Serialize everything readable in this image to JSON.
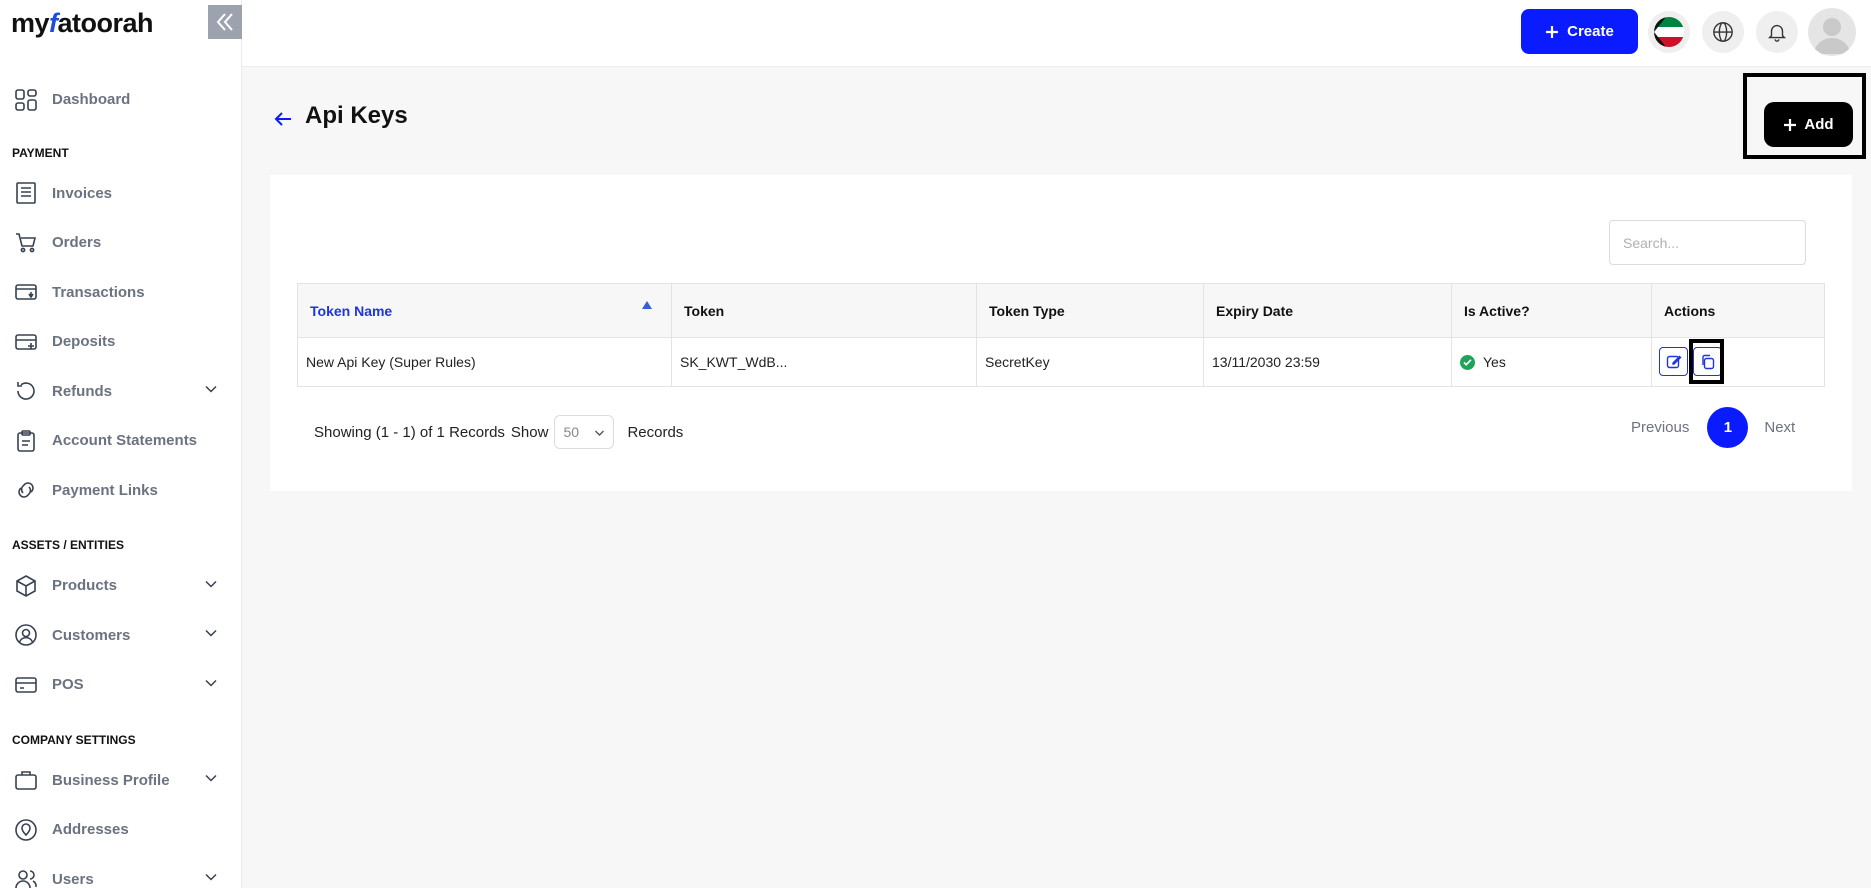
{
  "app": {
    "logo_left": "my",
    "logo_f": "f",
    "logo_right": "atoorah"
  },
  "sidebar": {
    "collapse_icon": "double-chevron-left-icon",
    "groups": [
      {
        "section": "",
        "items": [
          {
            "label": "Dashboard",
            "icon": "grid-icon",
            "expandable": false
          }
        ]
      },
      {
        "section": "PAYMENT",
        "items": [
          {
            "label": "Invoices",
            "icon": "invoice-icon",
            "expandable": false
          },
          {
            "label": "Orders",
            "icon": "cart-icon",
            "expandable": false
          },
          {
            "label": "Transactions",
            "icon": "transactions-icon",
            "expandable": false
          },
          {
            "label": "Deposits",
            "icon": "deposit-icon",
            "expandable": false
          },
          {
            "label": "Refunds",
            "icon": "refund-icon",
            "expandable": true
          },
          {
            "label": "Account Statements",
            "icon": "clipboard-icon",
            "expandable": false
          },
          {
            "label": "Payment Links",
            "icon": "link-icon",
            "expandable": false
          }
        ]
      },
      {
        "section": "ASSETS / ENTITIES",
        "items": [
          {
            "label": "Products",
            "icon": "box-icon",
            "expandable": true
          },
          {
            "label": "Customers",
            "icon": "user-circle-icon",
            "expandable": true
          },
          {
            "label": "POS",
            "icon": "card-icon",
            "expandable": true
          }
        ]
      },
      {
        "section": "COMPANY SETTINGS",
        "items": [
          {
            "label": "Business Profile",
            "icon": "briefcase-icon",
            "expandable": true
          },
          {
            "label": "Addresses",
            "icon": "location-icon",
            "expandable": false
          },
          {
            "label": "Users",
            "icon": "users-icon",
            "expandable": true
          }
        ]
      }
    ]
  },
  "topbar": {
    "create_label": "Create",
    "flag_icon": "kuwait-flag-icon",
    "globe_icon": "globe-icon",
    "bell_icon": "bell-icon",
    "avatar_icon": "avatar-icon"
  },
  "page": {
    "title": "Api Keys",
    "add_label": "Add"
  },
  "search": {
    "placeholder": "Search..."
  },
  "table": {
    "columns": [
      "Token Name",
      "Token",
      "Token Type",
      "Expiry Date",
      "Is Active?",
      "Actions"
    ],
    "sorted_column": "Token Name",
    "rows": [
      {
        "token_name": "New Api Key (Super Rules)",
        "token": "SK_KWT_WdB...",
        "token_type": "SecretKey",
        "expiry": "13/11/2030 23:59",
        "is_active": "Yes"
      }
    ]
  },
  "footer": {
    "showing": "Showing (1 - 1) of 1 Records",
    "show_label": "Show",
    "page_size": "50",
    "records_label": "Records",
    "previous": "Previous",
    "current_page": "1",
    "next": "Next"
  },
  "colors": {
    "accent": "#0a1cff",
    "sidebar_text": "#6b7280",
    "active_green": "#22a35b"
  }
}
